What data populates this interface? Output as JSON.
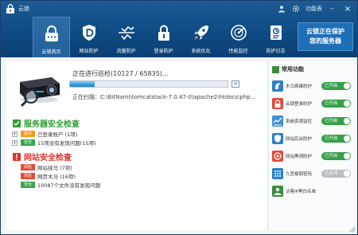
{
  "app": {
    "title": "云锁",
    "menu_label": "功能表",
    "accent": "#0f4b84"
  },
  "nav": {
    "tabs": [
      {
        "label": "云锁首页",
        "icon": "lock-icon",
        "active": true
      },
      {
        "label": "网站防护",
        "icon": "shield-d-icon",
        "active": false
      },
      {
        "label": "流量防护",
        "icon": "traffic-icon",
        "active": false
      },
      {
        "label": "登录防护",
        "icon": "login-lock-icon",
        "active": false
      },
      {
        "label": "系统优化",
        "icon": "rocket-icon",
        "active": false
      },
      {
        "label": "性能监控",
        "icon": "radar-icon",
        "active": false
      },
      {
        "label": "防护日志",
        "icon": "log-icon",
        "active": false
      }
    ]
  },
  "promo": {
    "line1": "云锁正在保护",
    "line2": "您的服务器"
  },
  "scan": {
    "status": "正在进行巡检(10127 / 65835)...",
    "progress": 0.155,
    "path": "正在扫描：C:\\BitNami\\tomcatstack-7.0.47-0\\apache2\\htdocs\\php..."
  },
  "server_check": {
    "title": "服务器安全检查",
    "rows": [
      {
        "badge": "提示",
        "text": "已登录账户 (1项)",
        "tone": "orange"
      },
      {
        "badge": "安全",
        "text": "15项没有发现问题(15项)",
        "tone": "green"
      }
    ]
  },
  "site_check": {
    "title": "网站安全检查",
    "rows": [
      {
        "badge": "风险",
        "text": "网站挂马 (7项)",
        "tone": "red"
      },
      {
        "badge": "风险",
        "text": "网页木马 (16项)",
        "tone": "red"
      },
      {
        "badge": "安全",
        "text": "10087个文件没有发现问题",
        "tone": "green"
      }
    ]
  },
  "sidebar": {
    "title": "常用功能",
    "items": [
      {
        "label": "木马病毒防护",
        "state": "已开启",
        "on": true
      },
      {
        "label": "云锁登录防护",
        "state": "已开启",
        "on": true
      },
      {
        "label": "系统资源监控",
        "state": "已开启",
        "on": true
      },
      {
        "label": "网站后台防护",
        "state": "已开启",
        "on": true
      },
      {
        "label": "网站黑洞防护",
        "state": "已开启",
        "on": true
      },
      {
        "label": "九宫格弱密码",
        "state": "已关闭",
        "on": false
      },
      {
        "label": "访客IP黑白名单",
        "state": "",
        "on": null
      }
    ]
  }
}
